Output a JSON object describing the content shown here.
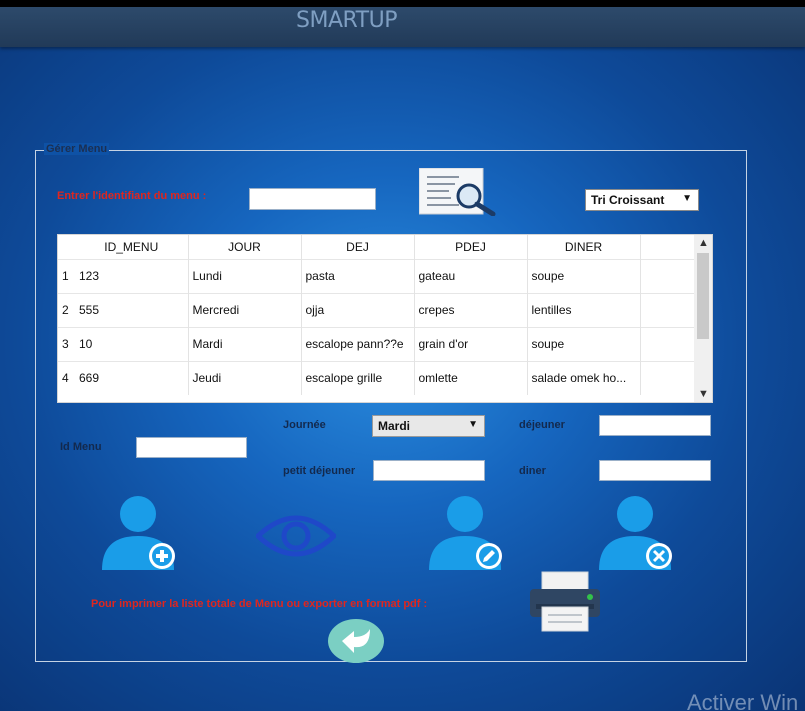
{
  "app": {
    "title": "SMARTUP"
  },
  "group": {
    "title": "Gérer Menu"
  },
  "search": {
    "label": "Entrer l'identifiant du menu :",
    "value": "",
    "button_icon": "search-document-icon"
  },
  "sort": {
    "selected": "Tri Croissant"
  },
  "table": {
    "columns": [
      "ID_MENU",
      "JOUR",
      "DEJ",
      "PDEJ",
      "DINER"
    ],
    "rows": [
      {
        "num": "1",
        "id": "123",
        "jour": "Lundi",
        "dej": "pasta",
        "pdej": "gateau",
        "diner": "soupe"
      },
      {
        "num": "2",
        "id": "555",
        "jour": "Mercredi",
        "dej": "ojja",
        "pdej": "crepes",
        "diner": "lentilles"
      },
      {
        "num": "3",
        "id": "10",
        "jour": "Mardi",
        "dej": "escalope pann??e",
        "pdej": "grain d'or",
        "diner": "soupe"
      },
      {
        "num": "4",
        "id": "669",
        "jour": "Jeudi",
        "dej": "escalope grille",
        "pdej": "omlette",
        "diner": "salade omek ho..."
      }
    ]
  },
  "form": {
    "id_label": "Id Menu",
    "id_value": "",
    "journee_label": "Journée",
    "journee_selected": "Mardi",
    "dejeuner_label": "déjeuner",
    "dejeuner_value": "",
    "petit_dejeuner_label": "petit déjeuner",
    "petit_dejeuner_value": "",
    "diner_label": "diner",
    "diner_value": ""
  },
  "actions": {
    "add_icon": "user-add-icon",
    "view_icon": "eye-icon",
    "edit_icon": "user-edit-icon",
    "delete_icon": "user-delete-icon",
    "print_icon": "printer-icon",
    "back_icon": "back-arrow-icon"
  },
  "print": {
    "label": "Pour imprimer la liste totale de Menu ou exporter en format pdf :"
  },
  "watermark": {
    "text": "Activer Win"
  },
  "colors": {
    "accent_red": "#e0261e",
    "user_icon": "#1a9de8",
    "background": "#1666bf"
  }
}
